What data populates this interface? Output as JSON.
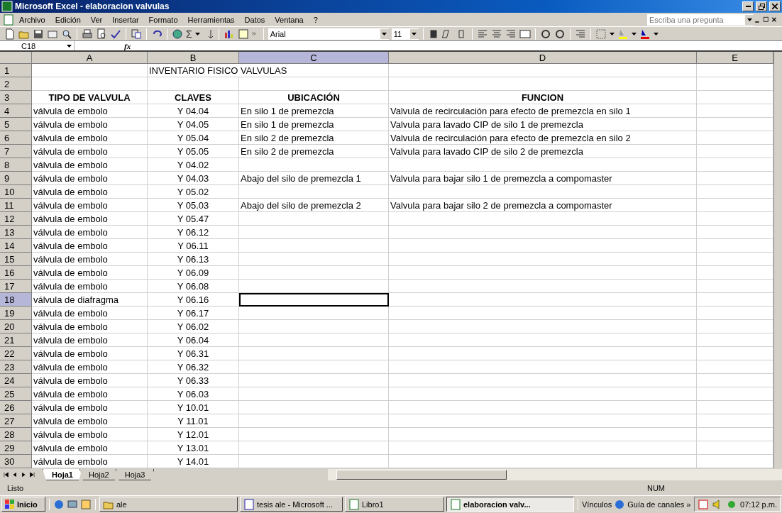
{
  "window": {
    "title": "Microsoft Excel - elaboracion valvulas"
  },
  "menu": [
    {
      "label": "Archivo"
    },
    {
      "label": "Edición"
    },
    {
      "label": "Ver"
    },
    {
      "label": "Insertar"
    },
    {
      "label": "Formato"
    },
    {
      "label": "Herramientas"
    },
    {
      "label": "Datos"
    },
    {
      "label": "Ventana"
    },
    {
      "label": "?"
    }
  ],
  "help_box": {
    "placeholder": "Escriba una pregunta"
  },
  "toolbar": {
    "sum": "Σ",
    "font": "Arial",
    "size": "11"
  },
  "formula_bar": {
    "name_box": "C18",
    "fx": "fx"
  },
  "columns": [
    {
      "label": "A",
      "selected": false
    },
    {
      "label": "B",
      "selected": false
    },
    {
      "label": "C",
      "selected": true
    },
    {
      "label": "D",
      "selected": false
    },
    {
      "label": "E",
      "selected": false
    }
  ],
  "rows": [
    {
      "num": "1",
      "selected": false,
      "kind": "title",
      "cells": [
        "",
        "INVENTARIO FISICO VALVULAS",
        "",
        ""
      ]
    },
    {
      "num": "2",
      "selected": false,
      "cells": [
        "",
        "",
        "",
        ""
      ]
    },
    {
      "num": "3",
      "selected": false,
      "kind": "header",
      "cells": [
        "TIPO DE VALVULA",
        "CLAVES",
        "UBICACIÓN",
        "FUNCION"
      ]
    },
    {
      "num": "4",
      "selected": false,
      "cells": [
        "válvula de embolo",
        "Y 04.04",
        "En silo 1 de premezcla",
        "Valvula de recirculación para efecto de premezcla en silo 1"
      ]
    },
    {
      "num": "5",
      "selected": false,
      "cells": [
        "válvula de embolo",
        "Y 04.05",
        "En silo 1 de premezcla",
        "Valvula para lavado CIP de silo 1 de premezcla"
      ]
    },
    {
      "num": "6",
      "selected": false,
      "cells": [
        "válvula de embolo",
        "Y 05.04",
        "En silo 2 de premezcla",
        "Valvula de recirculación para efecto de premezcla en silo 2"
      ]
    },
    {
      "num": "7",
      "selected": false,
      "cells": [
        "válvula de embolo",
        "Y 05.05",
        "En silo 2 de premezcla",
        "Valvula para lavado CIP de silo 2 de premezcla"
      ]
    },
    {
      "num": "8",
      "selected": false,
      "cells": [
        "válvula de embolo",
        "Y 04.02",
        "",
        ""
      ]
    },
    {
      "num": "9",
      "selected": false,
      "cells": [
        "válvula de embolo",
        "Y 04.03",
        "Abajo del silo de premezcla 1",
        "Valvula para bajar silo 1 de premezcla a compomaster"
      ]
    },
    {
      "num": "10",
      "selected": false,
      "cells": [
        "válvula de embolo",
        "Y 05.02",
        "",
        ""
      ]
    },
    {
      "num": "11",
      "selected": false,
      "cells": [
        "válvula de embolo",
        "Y 05.03",
        "Abajo del silo de premezcla 2",
        "Valvula para bajar silo 2 de premezcla a compomaster"
      ]
    },
    {
      "num": "12",
      "selected": false,
      "cells": [
        "válvula de embolo",
        "Y 05.47",
        "",
        ""
      ]
    },
    {
      "num": "13",
      "selected": false,
      "cells": [
        "válvula de embolo",
        "Y 06.12",
        "",
        ""
      ]
    },
    {
      "num": "14",
      "selected": false,
      "cells": [
        "válvula de embolo",
        "Y 06.11",
        "",
        ""
      ]
    },
    {
      "num": "15",
      "selected": false,
      "cells": [
        "válvula de embolo",
        "Y 06.13",
        "",
        ""
      ]
    },
    {
      "num": "16",
      "selected": false,
      "cells": [
        "válvula de embolo",
        "Y 06.09",
        "",
        ""
      ]
    },
    {
      "num": "17",
      "selected": false,
      "cells": [
        "válvula de embolo",
        "Y 06.08",
        "",
        ""
      ]
    },
    {
      "num": "18",
      "selected": true,
      "cells": [
        "válvula de diafragma",
        "Y 06.16",
        "",
        ""
      ]
    },
    {
      "num": "19",
      "selected": false,
      "cells": [
        "válvula de embolo",
        "Y 06.17",
        "",
        ""
      ]
    },
    {
      "num": "20",
      "selected": false,
      "cells": [
        "válvula de embolo",
        "Y 06.02",
        "",
        ""
      ]
    },
    {
      "num": "21",
      "selected": false,
      "cells": [
        "válvula de embolo",
        "Y 06.04",
        "",
        ""
      ]
    },
    {
      "num": "22",
      "selected": false,
      "cells": [
        "válvula de embolo",
        "Y 06.31",
        "",
        ""
      ]
    },
    {
      "num": "23",
      "selected": false,
      "cells": [
        "válvula de embolo",
        "Y 06.32",
        "",
        ""
      ]
    },
    {
      "num": "24",
      "selected": false,
      "cells": [
        "válvula de embolo",
        "Y 06.33",
        "",
        ""
      ]
    },
    {
      "num": "25",
      "selected": false,
      "cells": [
        "válvula de embolo",
        "Y 06.03",
        "",
        ""
      ]
    },
    {
      "num": "26",
      "selected": false,
      "cells": [
        "válvula de embolo",
        "Y 10.01",
        "",
        ""
      ]
    },
    {
      "num": "27",
      "selected": false,
      "cells": [
        "válvula de embolo",
        "Y 11.01",
        "",
        ""
      ]
    },
    {
      "num": "28",
      "selected": false,
      "cells": [
        "válvula de embolo",
        "Y 12.01",
        "",
        ""
      ]
    },
    {
      "num": "29",
      "selected": false,
      "cells": [
        "válvula de embolo",
        "Y 13.01",
        "",
        ""
      ]
    },
    {
      "num": "30",
      "selected": false,
      "cells": [
        "válvula de embolo",
        "Y 14.01",
        "",
        ""
      ]
    }
  ],
  "sheet_tabs": [
    {
      "label": "Hoja1",
      "selected": true
    },
    {
      "label": "Hoja2",
      "selected": false
    },
    {
      "label": "Hoja3",
      "selected": false
    }
  ],
  "status_bar": {
    "text": "Listo",
    "num": "NUM"
  },
  "taskbar": {
    "start": "Inicio",
    "tasks": [
      {
        "label": "ale",
        "kind": "folder",
        "selected": false
      },
      {
        "label": "tesis ale - Microsoft ...",
        "kind": "word",
        "selected": false
      },
      {
        "label": "Libro1",
        "kind": "excel",
        "selected": false
      },
      {
        "label": "elaboracion valv...",
        "kind": "excel",
        "selected": true
      }
    ],
    "links": [
      {
        "label": "Vínculos",
        "kind": "plain"
      },
      {
        "label": "Guía de canales",
        "kind": "ie"
      }
    ],
    "more": "»",
    "clock": "07:12 p.m."
  }
}
